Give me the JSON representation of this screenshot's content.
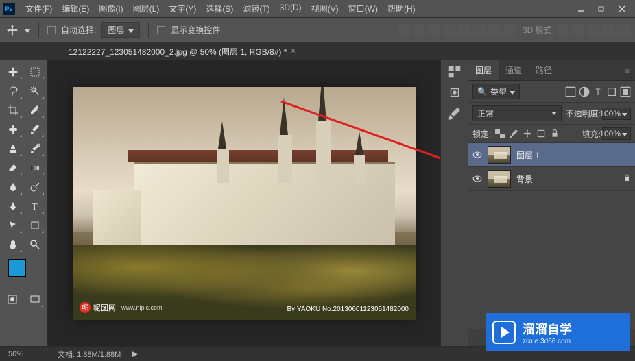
{
  "menu": {
    "items": [
      "文件(F)",
      "编辑(E)",
      "图像(I)",
      "图层(L)",
      "文字(Y)",
      "选择(S)",
      "滤镜(T)",
      "3D(D)",
      "视图(V)",
      "窗口(W)",
      "帮助(H)"
    ]
  },
  "options": {
    "auto_select_label": "自动选择:",
    "auto_select_target": "图层",
    "show_transform_label": "显示变换控件",
    "mode3d_label": "3D 模式:"
  },
  "document": {
    "tab_title": "12122227_123051482000_2.jpg @ 50% (图层 1, RGB/8#) *"
  },
  "canvas": {
    "watermark_site": "呢图网",
    "watermark_url": "www.nipic.com",
    "watermark_by": "By:YAOKU No.20130601123051482000"
  },
  "panel": {
    "tabs": [
      "图层",
      "通道",
      "路径"
    ],
    "active_tab": 0,
    "filter_label": "类型",
    "blend_mode": "正常",
    "opacity_label": "不透明度:",
    "opacity_value": "100%",
    "lock_label": "锁定:",
    "fill_label": "填充:",
    "fill_value": "100%",
    "layers": [
      {
        "name": "图层 1",
        "visible": true,
        "locked": false,
        "selected": true
      },
      {
        "name": "背景",
        "visible": true,
        "locked": true,
        "selected": false
      }
    ]
  },
  "status": {
    "zoom": "50%",
    "doc_label": "文档:",
    "doc_size": "1.88M/1.88M"
  },
  "brand": {
    "main": "溜溜自学",
    "sub": "zixue.3d66.com"
  }
}
